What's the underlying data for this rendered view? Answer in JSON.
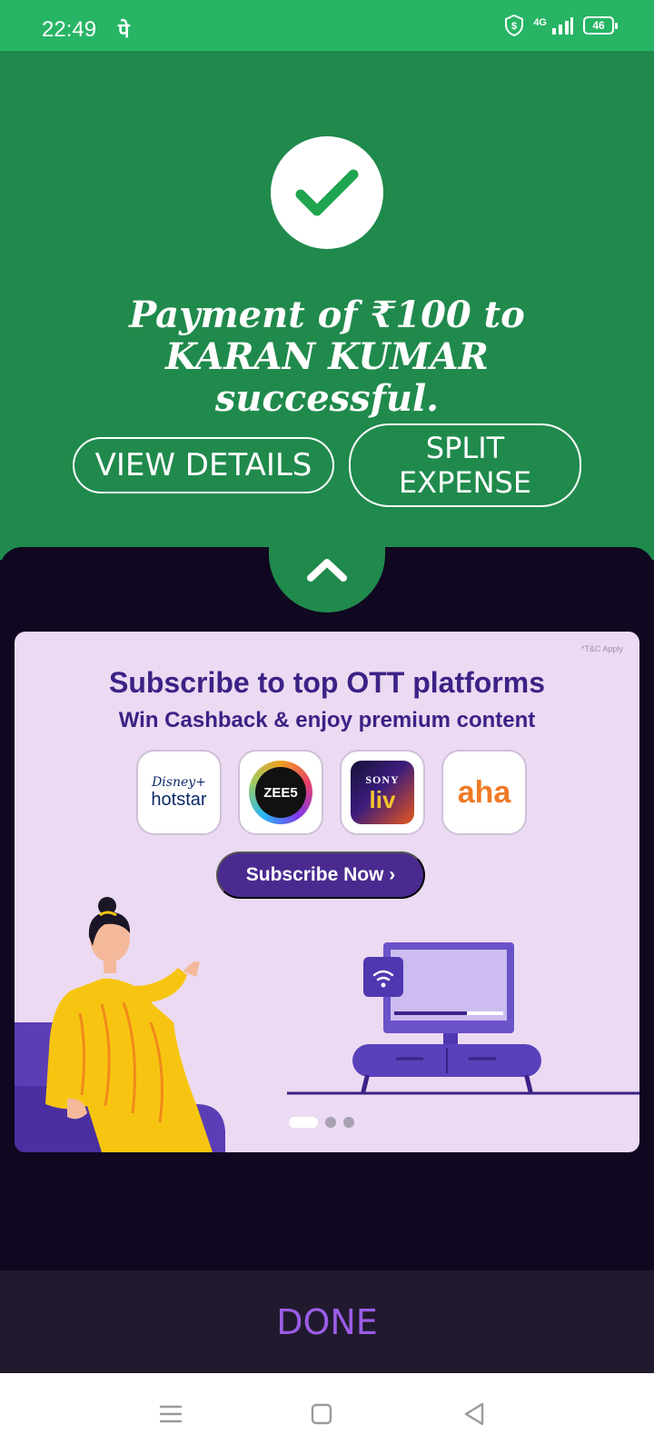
{
  "status_bar": {
    "time": "22:49",
    "app_indicator": "पे",
    "network": "4G",
    "battery": "46"
  },
  "success": {
    "message": "Payment of ₹100 to KARAN KUMAR successful.",
    "view_details_label": "VIEW DETAILS",
    "split_expense_label": "SPLIT EXPENSE",
    "colors": {
      "background": "#208a4c",
      "status_bar": "#27b565",
      "check": "#1fa54f"
    }
  },
  "banner": {
    "tc_text": "*T&C Apply",
    "title": "Subscribe to top OTT platforms",
    "subtitle": "Win Cashback & enjoy premium content",
    "platforms": [
      {
        "line1": "Disney+",
        "line2": "hotstar"
      },
      {
        "line1": "ZEE5"
      },
      {
        "line1": "SONY",
        "line2": "liv"
      },
      {
        "line1": "aha"
      }
    ],
    "cta_label": "Subscribe Now ›",
    "carousel": {
      "pages": 3,
      "active": 1
    }
  },
  "footer": {
    "done_label": "DONE",
    "done_color": "#9b5de5"
  },
  "nav_icons": [
    "menu-icon",
    "home-square-icon",
    "back-triangle-icon"
  ]
}
